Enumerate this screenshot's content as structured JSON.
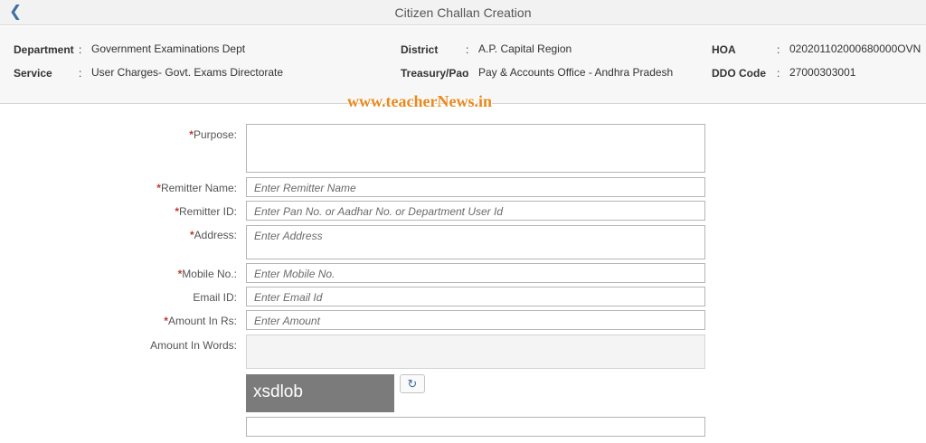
{
  "header": {
    "title": "Citizen Challan Creation",
    "back_icon": "chevron-left-icon"
  },
  "info": {
    "department_label": "Department",
    "department_value": "Government Examinations Dept",
    "service_label": "Service",
    "service_value": "User Charges- Govt. Exams Directorate",
    "district_label": "District",
    "district_value": "A.P. Capital Region",
    "treasury_label": "Treasury/Pao",
    "treasury_value": "Pay & Accounts Office - Andhra Pradesh",
    "hoa_label": "HOA",
    "hoa_value": "020201102000680000OVN",
    "ddo_label": "DDO Code",
    "ddo_value": "27000303001",
    "colon": ":"
  },
  "watermark": "www.teacherNews.in",
  "form": {
    "required_mark": "*",
    "purpose": {
      "label": "Purpose:",
      "placeholder": ""
    },
    "remitter_name": {
      "label": "Remitter Name:",
      "placeholder": "Enter Remitter Name"
    },
    "remitter_id": {
      "label": "Remitter ID:",
      "placeholder": "Enter Pan No. or Aadhar No. or Department User Id"
    },
    "address": {
      "label": "Address:",
      "placeholder": "Enter Address"
    },
    "mobile": {
      "label": "Mobile No.:",
      "placeholder": "Enter Mobile No."
    },
    "email": {
      "label": "Email ID:",
      "placeholder": "Enter Email Id"
    },
    "amount": {
      "label": "Amount In Rs:",
      "placeholder": "Enter Amount"
    },
    "amount_words": {
      "label": "Amount In Words:"
    },
    "captcha_text": "xsdlob",
    "refresh_icon": "refresh-icon"
  }
}
